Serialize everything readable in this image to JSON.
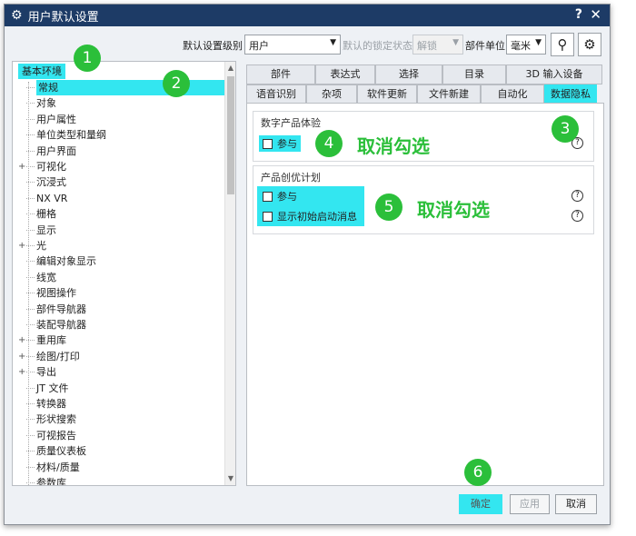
{
  "window": {
    "title": "用户默认设置",
    "help": "?",
    "close": "✕"
  },
  "toolbar": {
    "level_label": "默认设置级别",
    "level_value": "用户",
    "lock_label": "默认的锁定状态",
    "lock_value": "解锁",
    "unit_label": "部件单位",
    "unit_value": "毫米"
  },
  "tree": {
    "root": "基本环境",
    "items": [
      {
        "label": "常规",
        "exp": "",
        "selected": true
      },
      {
        "label": "对象",
        "exp": ""
      },
      {
        "label": "用户属性",
        "exp": ""
      },
      {
        "label": "单位类型和量纲",
        "exp": ""
      },
      {
        "label": "用户界面",
        "exp": ""
      },
      {
        "label": "可视化",
        "exp": "+"
      },
      {
        "label": "沉浸式",
        "exp": ""
      },
      {
        "label": "NX VR",
        "exp": ""
      },
      {
        "label": "栅格",
        "exp": ""
      },
      {
        "label": "显示",
        "exp": ""
      },
      {
        "label": "光",
        "exp": "+"
      },
      {
        "label": "编辑对象显示",
        "exp": ""
      },
      {
        "label": "线宽",
        "exp": ""
      },
      {
        "label": "视图操作",
        "exp": ""
      },
      {
        "label": "部件导航器",
        "exp": ""
      },
      {
        "label": "装配导航器",
        "exp": ""
      },
      {
        "label": "重用库",
        "exp": "+"
      },
      {
        "label": "绘图/打印",
        "exp": "+"
      },
      {
        "label": "导出",
        "exp": "+"
      },
      {
        "label": "JT 文件",
        "exp": ""
      },
      {
        "label": "转换器",
        "exp": ""
      },
      {
        "label": "形状搜索",
        "exp": ""
      },
      {
        "label": "可视报告",
        "exp": ""
      },
      {
        "label": "质量仪表板",
        "exp": ""
      },
      {
        "label": "材料/质量",
        "exp": ""
      },
      {
        "label": "参数库",
        "exp": ""
      }
    ]
  },
  "tabs_row1": [
    "部件",
    "表达式",
    "选择",
    "目录",
    "3D 输入设备"
  ],
  "tabs_row2": [
    "语音识别",
    "杂项",
    "软件更新",
    "文件新建",
    "自动化",
    "数据隐私"
  ],
  "groups": {
    "digital": {
      "title": "数字产品体验",
      "participate": "参与",
      "help": "?"
    },
    "innovation": {
      "title": "产品创优计划",
      "participate": "参与",
      "show_startup": "显示初始启动消息",
      "help": "?"
    }
  },
  "annotations": {
    "steps": [
      "1",
      "2",
      "3",
      "4",
      "5",
      "6"
    ],
    "uncheck": "取消勾选"
  },
  "buttons": {
    "ok": "确定",
    "apply": "应用",
    "cancel": "取消"
  },
  "colors": {
    "highlight": "#33e6f0",
    "annotation": "#2bbf3a",
    "titlebar": "#1d3b66"
  }
}
